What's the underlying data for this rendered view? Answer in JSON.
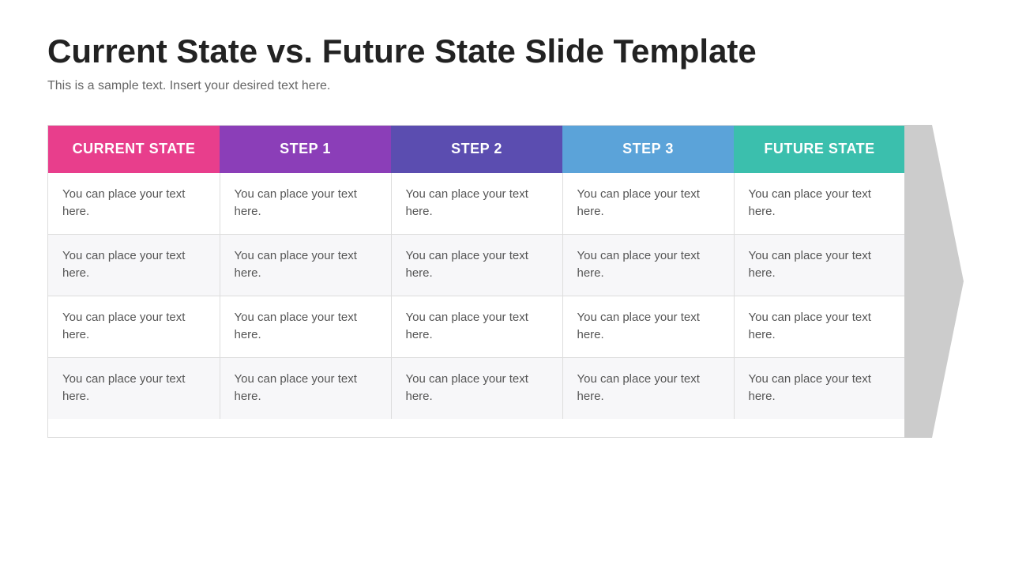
{
  "slide": {
    "title": "Current State vs. Future State Slide Template",
    "subtitle": "This is a sample text. Insert your desired text here.",
    "table": {
      "headers": [
        {
          "id": "current-state",
          "label": "CURRENT STATE"
        },
        {
          "id": "step1",
          "label": "STEP 1"
        },
        {
          "id": "step2",
          "label": "STEP 2"
        },
        {
          "id": "step3",
          "label": "STEP 3"
        },
        {
          "id": "future-state",
          "label": "FUTURE STATE"
        }
      ],
      "rows": [
        [
          "You can place your text here.",
          "You can place your text here.",
          "You can place your text here.",
          "You can place your text here.",
          "You can place your text here."
        ],
        [
          "You can place your text here.",
          "You can place your text here.",
          "You can place your text here.",
          "You can place your text here.",
          "You can place your text here."
        ],
        [
          "You can place your text here.",
          "You can place your text here.",
          "You can place your text here.",
          "You can place your text here.",
          "You can place your text here."
        ],
        [
          "You can place your text here.",
          "You can place your text here.",
          "You can place your text here.",
          "You can place your text here.",
          "You can place your text here."
        ]
      ]
    },
    "arrow": {
      "color": "#cccccc"
    }
  }
}
